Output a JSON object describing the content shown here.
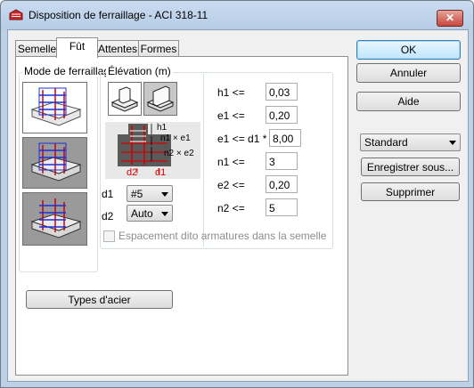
{
  "window": {
    "title": "Disposition de ferraillage - ACI 318-11",
    "close_label": "✕"
  },
  "tabs": [
    {
      "label": "Semelle",
      "active": false
    },
    {
      "label": "Fût",
      "active": true
    },
    {
      "label": "Attentes",
      "active": false
    },
    {
      "label": "Formes",
      "active": false
    }
  ],
  "mode_group": {
    "label": "Mode de ferraillage"
  },
  "elevation_group": {
    "label": "Élévation (m)"
  },
  "diagram_labels": {
    "h1": "h1",
    "n1e1": "n1 × e1",
    "n2e2": "n2 × e2",
    "d2": "d2",
    "d1": "d1"
  },
  "bars": {
    "d1_label": "d1",
    "d1_value": "#5",
    "d2_label": "d2",
    "d2_value": "Auto"
  },
  "params": [
    {
      "label": "h1 <=",
      "value": "0,03"
    },
    {
      "label": "e1 <=",
      "value": "0,20"
    },
    {
      "label": "e1 <= d1 *",
      "value": "8,00"
    },
    {
      "label": "n1 <=",
      "value": "3"
    },
    {
      "label": "e2 <=",
      "value": "0,20"
    },
    {
      "label": "n2 <=",
      "value": "5"
    }
  ],
  "checkbox": {
    "label": "Espacement dito armatures dans la semelle",
    "checked": false,
    "enabled": false
  },
  "buttons": {
    "steel_types": "Types d'acier",
    "ok": "OK",
    "cancel": "Annuler",
    "help": "Aide",
    "save_as": "Enregistrer sous...",
    "delete": "Supprimer"
  },
  "preset": {
    "value": "Standard"
  },
  "colors": {
    "rebar_red": "#d00000",
    "rebar_blue": "#1c2fd8",
    "accent": "#3c7fb1"
  }
}
